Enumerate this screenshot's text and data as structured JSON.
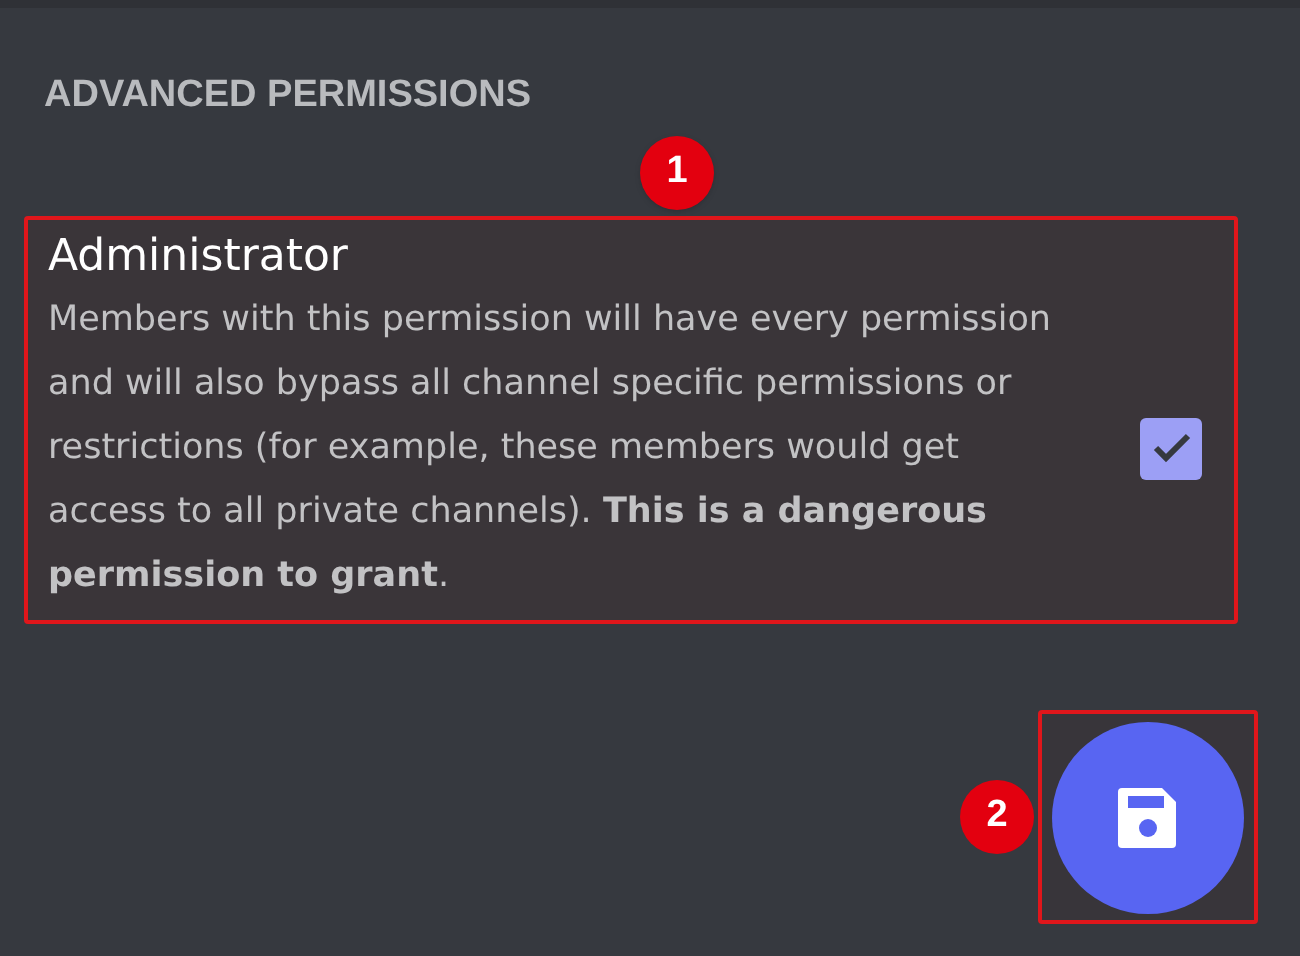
{
  "section_title": "ADVANCED PERMISSIONS",
  "permission": {
    "name": "Administrator",
    "description": "Members with this permission will have every permission and will also bypass all channel specific permissions or restrictions (for example, these members would get access to all private channels). **This is a dangerous permission to grant**.",
    "checked": true,
    "callout": "1"
  },
  "save_button": {
    "callout": "2"
  }
}
